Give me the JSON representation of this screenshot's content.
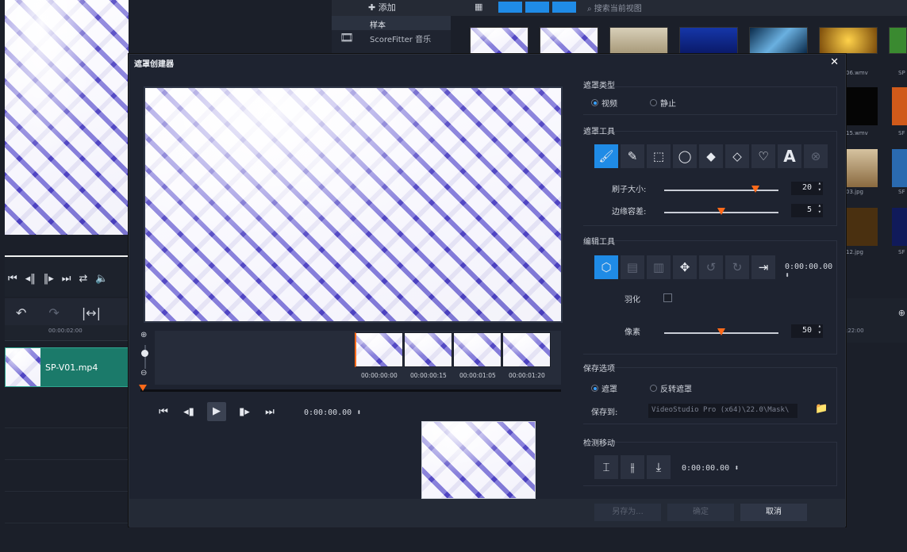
{
  "background": {
    "library": {
      "add_label": "添加",
      "items": [
        "样本",
        "ScoreFitter 音乐"
      ],
      "search_placeholder": "搜索当前视图",
      "captions": [
        "06.wmv",
        "15.wmv",
        "03.jpg",
        "12.jpg",
        "SP",
        "SF",
        "SF",
        "SF"
      ]
    },
    "timeline": {
      "ruler_tc": "00:00:02:00",
      "right_ruler_tc": ":22:00",
      "clip_label": "SP-V01.mp4"
    }
  },
  "dialog": {
    "title": "遮罩创建器",
    "close_glyph": "✕",
    "timeline_codes": [
      "00:00:00:00",
      "00:00:00:15",
      "00:00:01:05",
      "00:00:01:20"
    ],
    "playback_timecode": "0:00:00.00",
    "mask_type": {
      "title": "遮罩类型",
      "options": [
        "视频",
        "静止"
      ],
      "selected": "视频"
    },
    "mask_tools": {
      "title": "遮罩工具",
      "brush_size_label": "刷子大小:",
      "brush_size_value": "20",
      "brush_size_level": 0.8,
      "edge_tolerance_label": "边缘容差:",
      "edge_tolerance_value": "5",
      "edge_tolerance_level": 0.5
    },
    "edit_tools": {
      "title": "编辑工具",
      "timecode": "0:00:00.00",
      "feather_label": "羽化",
      "pixel_label": "像素",
      "pixel_value": "50",
      "pixel_level": 0.5
    },
    "save_options": {
      "title": "保存选项",
      "options": [
        "遮罩",
        "反转遮罩"
      ],
      "selected": "遮罩",
      "save_to_label": "保存到:",
      "save_path": "VideoStudio Pro (x64)\\22.0\\Mask\\"
    },
    "detect_motion": {
      "title": "检测移动",
      "timecode": "0:00:00.00"
    },
    "buttons": {
      "save_as": "另存为...",
      "ok": "确定",
      "cancel": "取消"
    }
  },
  "colors": {
    "accent": "#1f8be6",
    "slider_knob": "#ff6a1a",
    "clip_track": "#1b7a6a"
  }
}
